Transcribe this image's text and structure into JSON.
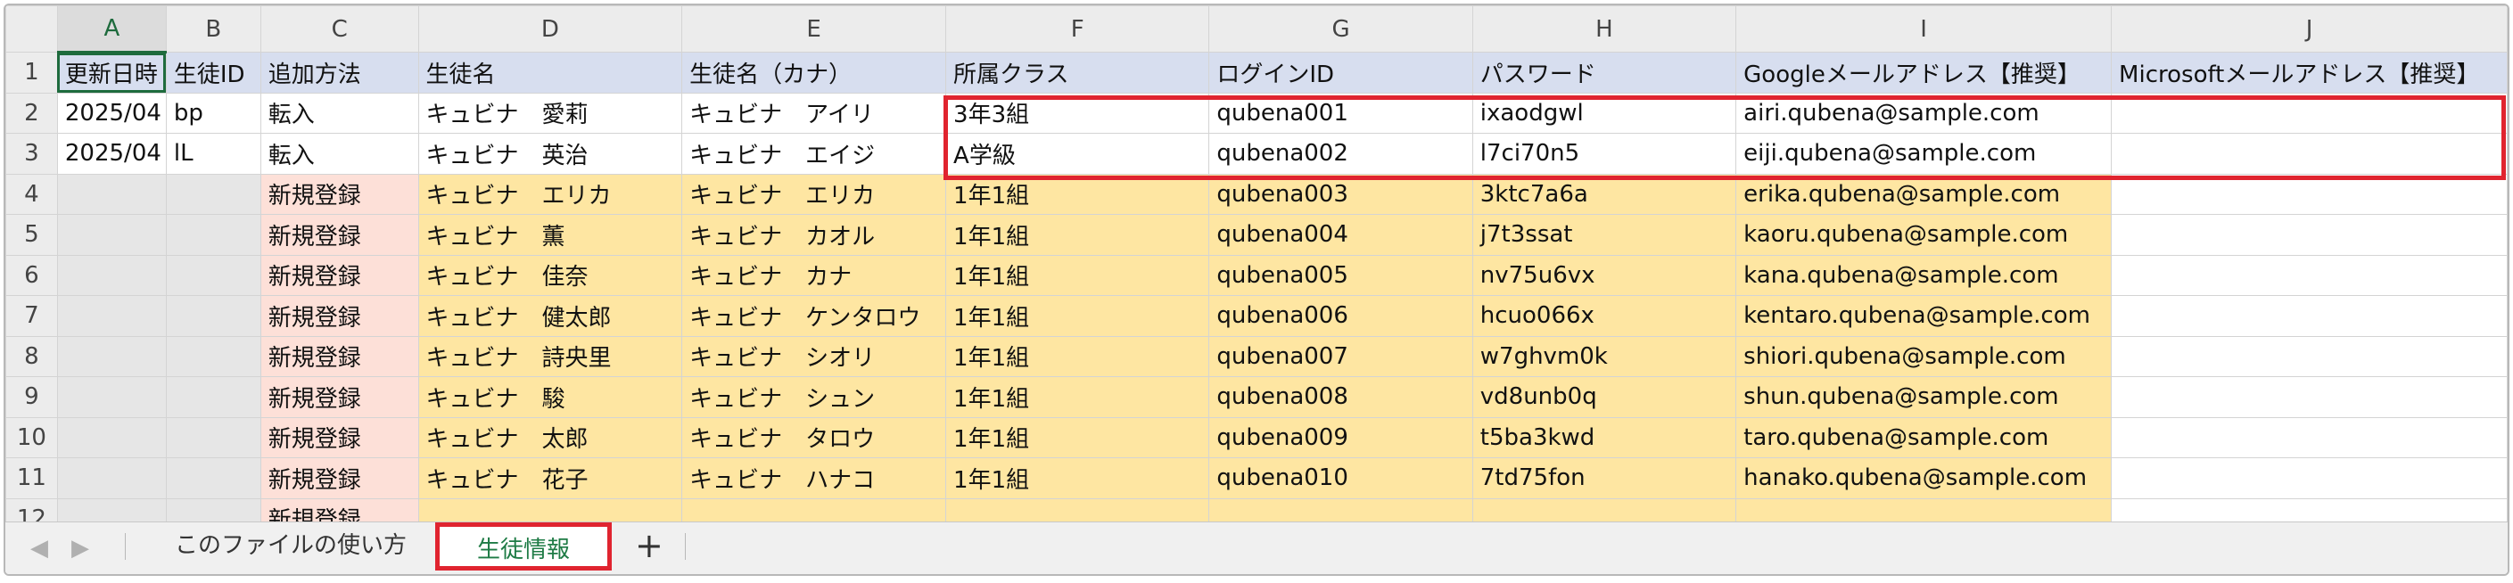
{
  "columns": [
    "A",
    "B",
    "C",
    "D",
    "E",
    "F",
    "G",
    "H",
    "I",
    "J"
  ],
  "selected_column": "A",
  "header_row": {
    "row_number": "1",
    "cells": [
      "更新日時",
      "生徒ID",
      "追加方法",
      "生徒名",
      "生徒名（カナ）",
      "所属クラス",
      "ログインID",
      "パスワード",
      "Googleメールアドレス【推奨】",
      "Microsoftメールアドレス【推奨】"
    ]
  },
  "rows": [
    {
      "row_number": "2",
      "cells": [
        "2025/04",
        "bp",
        "転入",
        "キュビナ　愛莉",
        "キュビナ　アイリ",
        "3年3組",
        "qubena001",
        "ixaodgwl",
        "airi.qubena@sample.com",
        ""
      ]
    },
    {
      "row_number": "3",
      "cells": [
        "2025/04",
        "lL",
        "転入",
        "キュビナ　英治",
        "キュビナ　エイジ",
        "A学級",
        "qubena002",
        "l7ci70n5",
        "eiji.qubena@sample.com",
        ""
      ]
    },
    {
      "row_number": "4",
      "cells": [
        "",
        "",
        "新規登録",
        "キュビナ　エリカ",
        "キュビナ　エリカ",
        "1年1組",
        "qubena003",
        "3ktc7a6a",
        "erika.qubena@sample.com",
        ""
      ]
    },
    {
      "row_number": "5",
      "cells": [
        "",
        "",
        "新規登録",
        "キュビナ　薫",
        "キュビナ　カオル",
        "1年1組",
        "qubena004",
        "j7t3ssat",
        "kaoru.qubena@sample.com",
        ""
      ]
    },
    {
      "row_number": "6",
      "cells": [
        "",
        "",
        "新規登録",
        "キュビナ　佳奈",
        "キュビナ　カナ",
        "1年1組",
        "qubena005",
        "nv75u6vx",
        "kana.qubena@sample.com",
        ""
      ]
    },
    {
      "row_number": "7",
      "cells": [
        "",
        "",
        "新規登録",
        "キュビナ　健太郎",
        "キュビナ　ケンタロウ",
        "1年1組",
        "qubena006",
        "hcuo066x",
        "kentaro.qubena@sample.com",
        ""
      ]
    },
    {
      "row_number": "8",
      "cells": [
        "",
        "",
        "新規登録",
        "キュビナ　詩央里",
        "キュビナ　シオリ",
        "1年1組",
        "qubena007",
        "w7ghvm0k",
        "shiori.qubena@sample.com",
        ""
      ]
    },
    {
      "row_number": "9",
      "cells": [
        "",
        "",
        "新規登録",
        "キュビナ　駿",
        "キュビナ　シュン",
        "1年1組",
        "qubena008",
        "vd8unb0q",
        "shun.qubena@sample.com",
        ""
      ]
    },
    {
      "row_number": "10",
      "cells": [
        "",
        "",
        "新規登録",
        "キュビナ　太郎",
        "キュビナ　タロウ",
        "1年1組",
        "qubena009",
        "t5ba3kwd",
        "taro.qubena@sample.com",
        ""
      ]
    },
    {
      "row_number": "11",
      "cells": [
        "",
        "",
        "新規登録",
        "キュビナ　花子",
        "キュビナ　ハナコ",
        "1年1組",
        "qubena010",
        "7td75fon",
        "hanako.qubena@sample.com",
        ""
      ]
    },
    {
      "row_number": "12",
      "cells": [
        "",
        "",
        "新規登録",
        "",
        "",
        "",
        "",
        "",
        "",
        ""
      ]
    }
  ],
  "tabs": {
    "prev_icon": "◀",
    "next_icon": "▶",
    "sheets": [
      "このファイルの使い方",
      "生徒情報"
    ],
    "active_sheet": "生徒情報",
    "add_label": "+"
  },
  "colors": {
    "header_fill": "#d7deef",
    "required_fill": "#fee6a2",
    "method_fill": "#fde0d8",
    "highlight_border": "#e0242f",
    "active_tab_text": "#1e7b45"
  }
}
